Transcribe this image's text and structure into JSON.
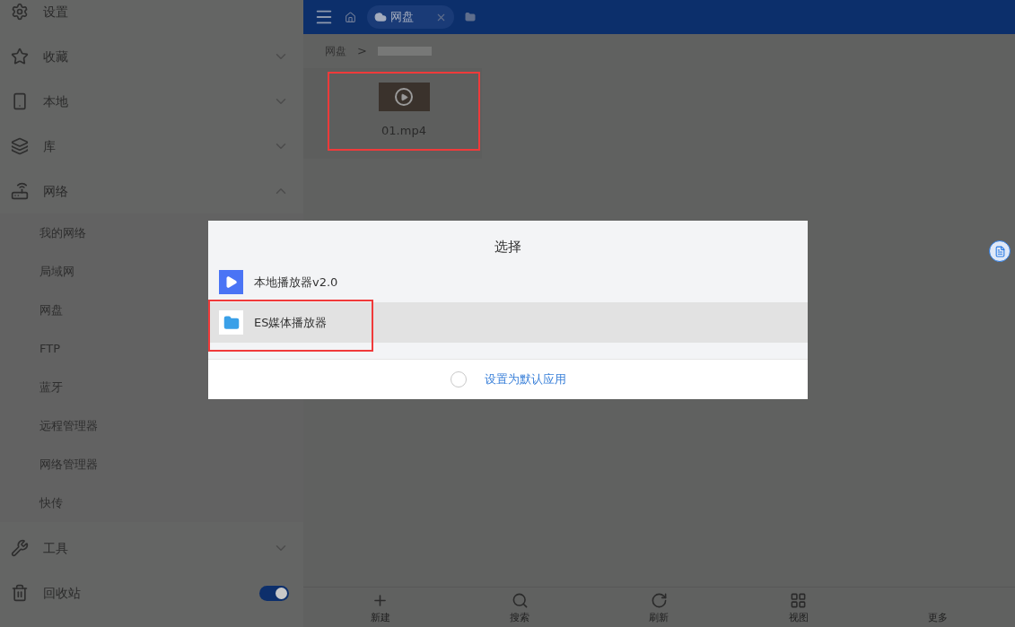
{
  "sidebar": {
    "items": [
      {
        "label": "设置"
      },
      {
        "label": "收藏",
        "expanded": false
      },
      {
        "label": "本地",
        "expanded": false
      },
      {
        "label": "库",
        "expanded": false
      },
      {
        "label": "网络",
        "expanded": true,
        "children": [
          {
            "label": "我的网络"
          },
          {
            "label": "局域网"
          },
          {
            "label": "网盘"
          },
          {
            "label": "FTP"
          },
          {
            "label": "蓝牙"
          },
          {
            "label": "远程管理器"
          },
          {
            "label": "网络管理器"
          },
          {
            "label": "快传"
          }
        ]
      },
      {
        "label": "工具",
        "expanded": false
      },
      {
        "label": "回收站",
        "toggle": {
          "on": true
        }
      }
    ]
  },
  "tabs": [
    {
      "label": "网盘",
      "selected": true
    }
  ],
  "breadcrumb": {
    "items": [
      "网盘"
    ],
    "separator": ">"
  },
  "files": [
    {
      "name": "01.mp4",
      "highlighted": true
    }
  ],
  "dialog": {
    "title": "选择",
    "options": [
      {
        "label": "本地播放器v2.0",
        "selected": false,
        "highlighted": false
      },
      {
        "label": "ES媒体播放器",
        "selected": true,
        "highlighted": true
      }
    ],
    "default_option": {
      "label": "设置为默认应用",
      "checked": false
    }
  },
  "bottom_bar": [
    {
      "label": "新建"
    },
    {
      "label": "搜索"
    },
    {
      "label": "刷新"
    },
    {
      "label": "视图"
    },
    {
      "label": "更多"
    }
  ]
}
